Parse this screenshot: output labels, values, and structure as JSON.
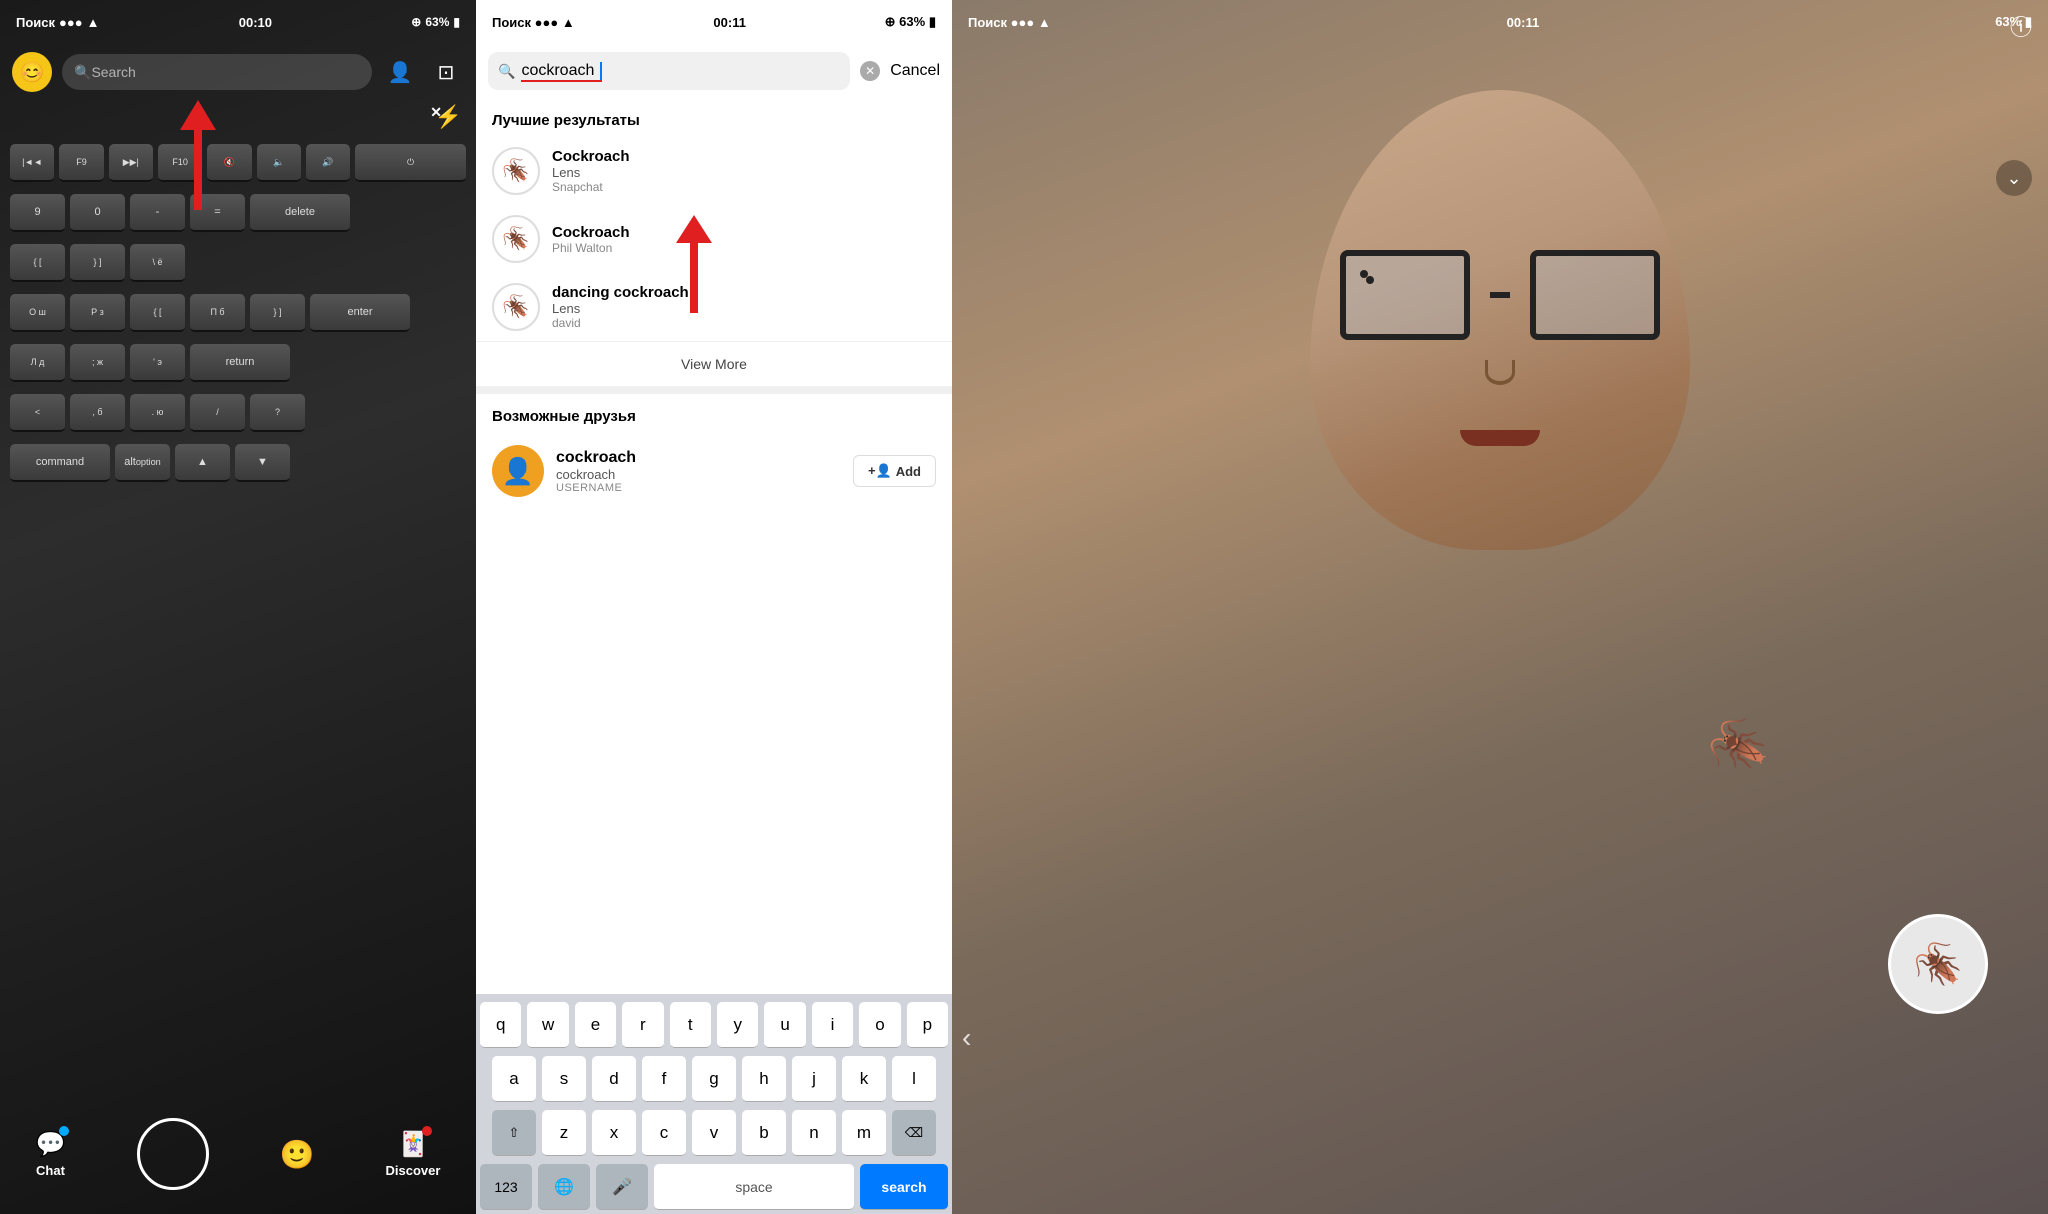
{
  "panel_left": {
    "status": {
      "carrier": "Поиск",
      "signal": "●●●●",
      "wifi": "wifi",
      "time": "00:10",
      "location": "⊕",
      "battery_pct": "63%"
    },
    "search_placeholder": "Search",
    "bottom_nav": {
      "chat_label": "Chat",
      "discover_label": "Discover"
    }
  },
  "panel_middle": {
    "status": {
      "carrier": "Поиск",
      "signal": "●●●●",
      "wifi": "wifi",
      "time": "00:11",
      "battery_pct": "63%"
    },
    "search_query": "cockroach",
    "cancel_label": "Cancel",
    "section_best": "Лучшие результаты",
    "results": [
      {
        "name": "Cockroach",
        "type": "Lens",
        "source": "Snapchat"
      },
      {
        "name": "Cockroach",
        "type": "",
        "source": "Phil Walton"
      },
      {
        "name": "dancing cockroach",
        "type": "Lens",
        "source": "david"
      }
    ],
    "view_more": "View More",
    "section_friends": "Возможные друзья",
    "friends": [
      {
        "display_name": "cockroach",
        "username": "cockroach",
        "label": "USERNAME",
        "add_label": "+ Add"
      }
    ],
    "keyboard": {
      "rows": [
        [
          "q",
          "w",
          "e",
          "r",
          "t",
          "y",
          "u",
          "i",
          "o",
          "p"
        ],
        [
          "a",
          "s",
          "d",
          "f",
          "g",
          "h",
          "j",
          "k",
          "l"
        ],
        [
          "⇧",
          "z",
          "x",
          "c",
          "v",
          "b",
          "n",
          "m",
          "⌫"
        ],
        [
          "123",
          "🌐",
          "🎤",
          "space",
          "search"
        ]
      ]
    }
  },
  "panel_right": {
    "status": {
      "carrier": "Поиск",
      "signal": "●●●●",
      "time": "00:11",
      "battery_pct": "63%"
    }
  },
  "icons": {
    "search": "🔍",
    "add_friend": "👤+",
    "scan": "⊡",
    "flash": "⚡",
    "close_flash": "✕",
    "chat_icon": "💬",
    "discover_icon": "🃏",
    "clear": "✕",
    "info": "ⓘ",
    "chevron_down": "⌄",
    "arrow_left": "‹",
    "cockroach": "🪳",
    "avatar_emoji": "😊"
  }
}
